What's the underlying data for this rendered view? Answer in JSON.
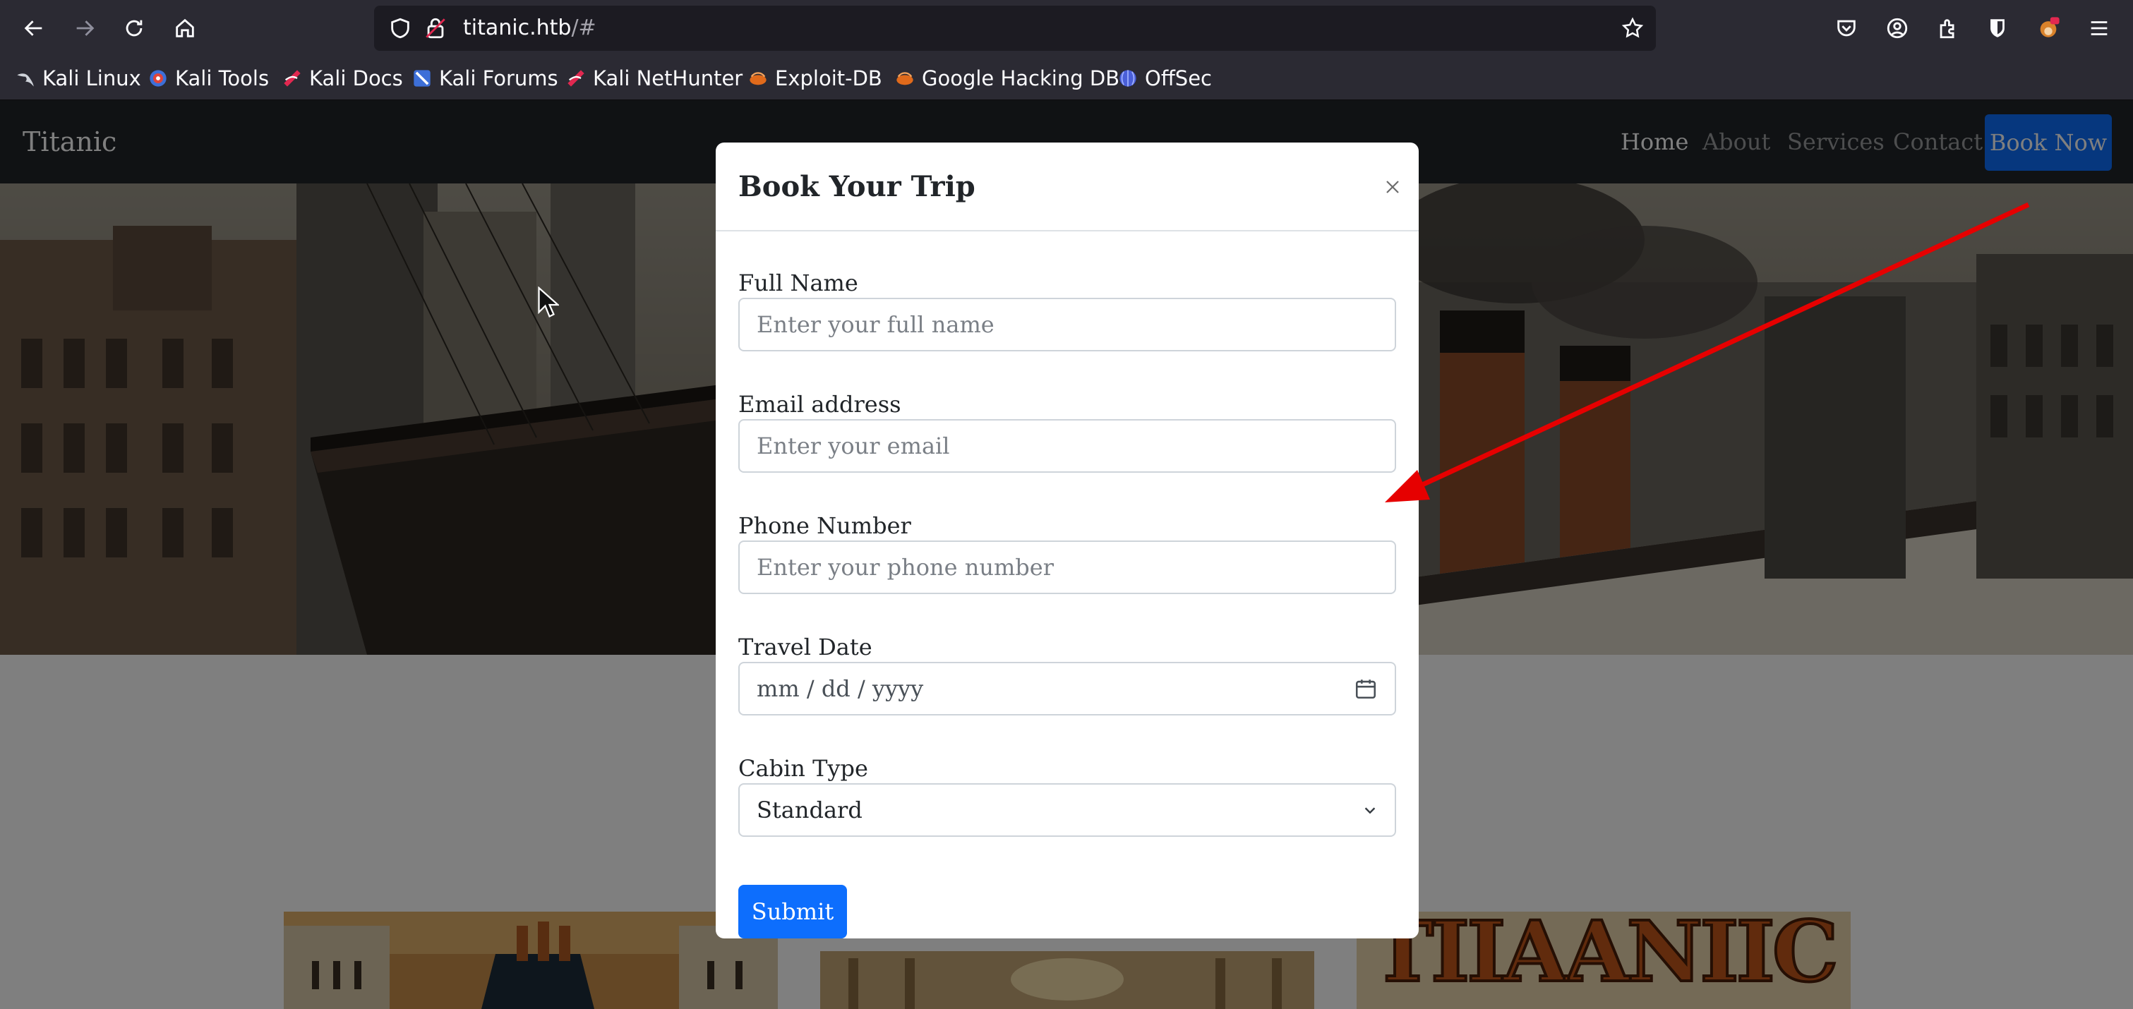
{
  "browser": {
    "url_host": "titanic.htb",
    "url_path": "/#",
    "bookmarks": [
      {
        "label": "Kali Linux",
        "icon": "kali-dragon-icon"
      },
      {
        "label": "Kali Tools",
        "icon": "kali-tools-icon"
      },
      {
        "label": "Kali Docs",
        "icon": "kali-docs-icon"
      },
      {
        "label": "Kali Forums",
        "icon": "kali-forums-icon"
      },
      {
        "label": "Kali NetHunter",
        "icon": "kali-nethunter-icon"
      },
      {
        "label": "Exploit-DB",
        "icon": "exploit-db-icon"
      },
      {
        "label": "Google Hacking DB",
        "icon": "ghdb-icon"
      },
      {
        "label": "OffSec",
        "icon": "offsec-icon"
      }
    ]
  },
  "site": {
    "brand": "Titanic",
    "nav": [
      {
        "label": "Home",
        "active": true
      },
      {
        "label": "About",
        "active": false
      },
      {
        "label": "Services",
        "active": false
      },
      {
        "label": "Contact",
        "active": false
      }
    ],
    "book_now": "Book Now"
  },
  "modal": {
    "title": "Book Your Trip",
    "close_glyph": "×",
    "fields": {
      "name": {
        "label": "Full Name",
        "placeholder": "Enter your full name"
      },
      "email": {
        "label": "Email address",
        "placeholder": "Enter your email"
      },
      "phone": {
        "label": "Phone Number",
        "placeholder": "Enter your phone number"
      },
      "date": {
        "label": "Travel Date",
        "placeholder": "mm / dd / yyyy"
      },
      "cabin": {
        "label": "Cabin Type",
        "value": "Standard"
      }
    },
    "submit": "Submit"
  },
  "colors": {
    "accent": "#0d6efd",
    "navbar": "#212529",
    "annotation_arrow": "#e60000"
  },
  "card_texts": [
    "TIIAANIIC"
  ]
}
